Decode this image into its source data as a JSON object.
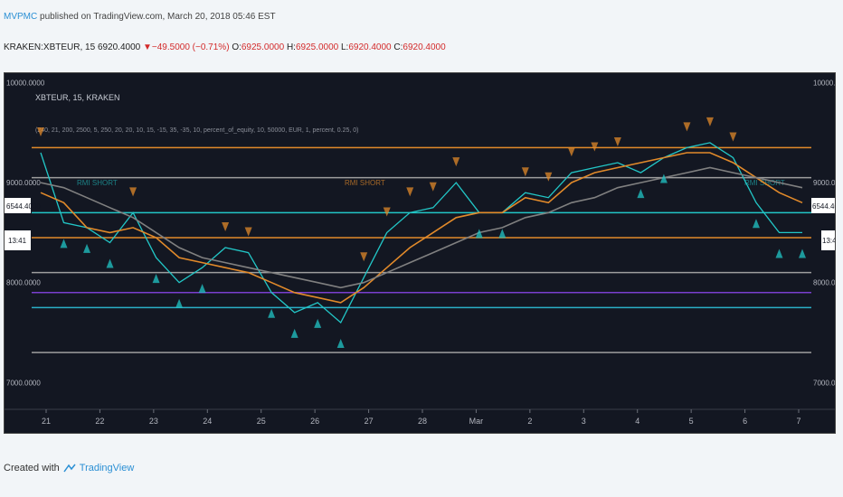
{
  "header": {
    "publisher_author": "MVPMC",
    "publisher_text": "published on TradingView.com, March 20, 2018 05:46 EST"
  },
  "ohlc": {
    "symbol": "KRAKEN:XBTEUR, 15",
    "last": "6920.4000",
    "arrow": "▼",
    "change": "−49.5000 (−0.71%)",
    "o_label": "O:",
    "o": "6925.0000",
    "h_label": "H:",
    "h": "6925.0000",
    "l_label": "L:",
    "l": "6920.4000",
    "c_label": "C:",
    "c": "6920.4000"
  },
  "chart_overlay": {
    "pane_title": "XBTEUR, 15, KRAKEN",
    "indicator_params": "(240, 21, 200, 2500, 5, 250, 20, 20, 10, 15, -15, 35, -35, 10, percent_of_equity, 10, 50000, EUR, 1, percent, 0.25, 0)",
    "annotation_left": "RMI SHORT",
    "annotation_mid": "RMI SHORT",
    "annotation_right": "RMI SHORT"
  },
  "price_badges": {
    "last_price": "6544.4000",
    "countdown": "13:41"
  },
  "footer": {
    "created_with": "Created with",
    "brand": "TradingView"
  },
  "chart_data": {
    "type": "line",
    "title": "XBTEUR, 15, KRAKEN",
    "x": [
      "21",
      "21.5",
      "22",
      "22.3",
      "22.6",
      "23",
      "23.5",
      "24",
      "24.3",
      "24.7",
      "25",
      "25.5",
      "26",
      "26.5",
      "27",
      "27.3",
      "27.7",
      "28",
      "28.5",
      "Mar",
      "Mar.5",
      "2",
      "2.5",
      "3",
      "3.5",
      "4",
      "4.5",
      "5",
      "5.5",
      "6",
      "6.3",
      "6.7",
      "7",
      "7.5"
    ],
    "xticks": [
      "21",
      "22",
      "23",
      "24",
      "25",
      "26",
      "27",
      "28",
      "Mar",
      "2",
      "3",
      "4",
      "5",
      "6",
      "7"
    ],
    "yticks": [
      "10000.0000",
      "9000.0000",
      "8000.0000",
      "7000.0000"
    ],
    "ylim": [
      6750,
      10050
    ],
    "series": [
      {
        "values": [
          9300,
          8600,
          8550,
          8400,
          8700,
          8250,
          8000,
          8150,
          8350,
          8300,
          7900,
          7700,
          7800,
          7600,
          8050,
          8500,
          8700,
          8750,
          9000,
          8700,
          8700,
          8900,
          8850,
          9100,
          9150,
          9200,
          9100,
          9250,
          9350,
          9400,
          9250,
          8800,
          8500,
          8500
        ],
        "color": "#22c7c7"
      },
      {
        "values": [
          8900,
          8800,
          8550,
          8500,
          8550,
          8450,
          8250,
          8200,
          8150,
          8100,
          8000,
          7900,
          7850,
          7800,
          7950,
          8150,
          8350,
          8500,
          8650,
          8700,
          8700,
          8850,
          8800,
          9000,
          9100,
          9150,
          9200,
          9250,
          9300,
          9300,
          9200,
          9050,
          8900,
          8800
        ],
        "color": "#e28a2a"
      },
      {
        "values": [
          9000,
          8950,
          8850,
          8750,
          8650,
          8500,
          8350,
          8250,
          8200,
          8150,
          8100,
          8050,
          8000,
          7950,
          8000,
          8100,
          8200,
          8300,
          8400,
          8500,
          8550,
          8650,
          8700,
          8800,
          8850,
          8950,
          9000,
          9050,
          9100,
          9150,
          9100,
          9050,
          9000,
          8950
        ],
        "color": "#808080"
      }
    ],
    "levels": [
      {
        "value": 7300,
        "color": "#9e9e9e"
      },
      {
        "value": 7750,
        "color": "#2ab0c8"
      },
      {
        "value": 7900,
        "color": "#7a3fcf"
      },
      {
        "value": 8100,
        "color": "#9e9e9e"
      },
      {
        "value": 8450,
        "color": "#e28a2a"
      },
      {
        "value": 8700,
        "color": "#22c7c7"
      },
      {
        "value": 9350,
        "color": "#e28a2a"
      },
      {
        "value": 9050,
        "color": "#9e9e9e"
      }
    ],
    "grid": false,
    "legend": "none"
  }
}
